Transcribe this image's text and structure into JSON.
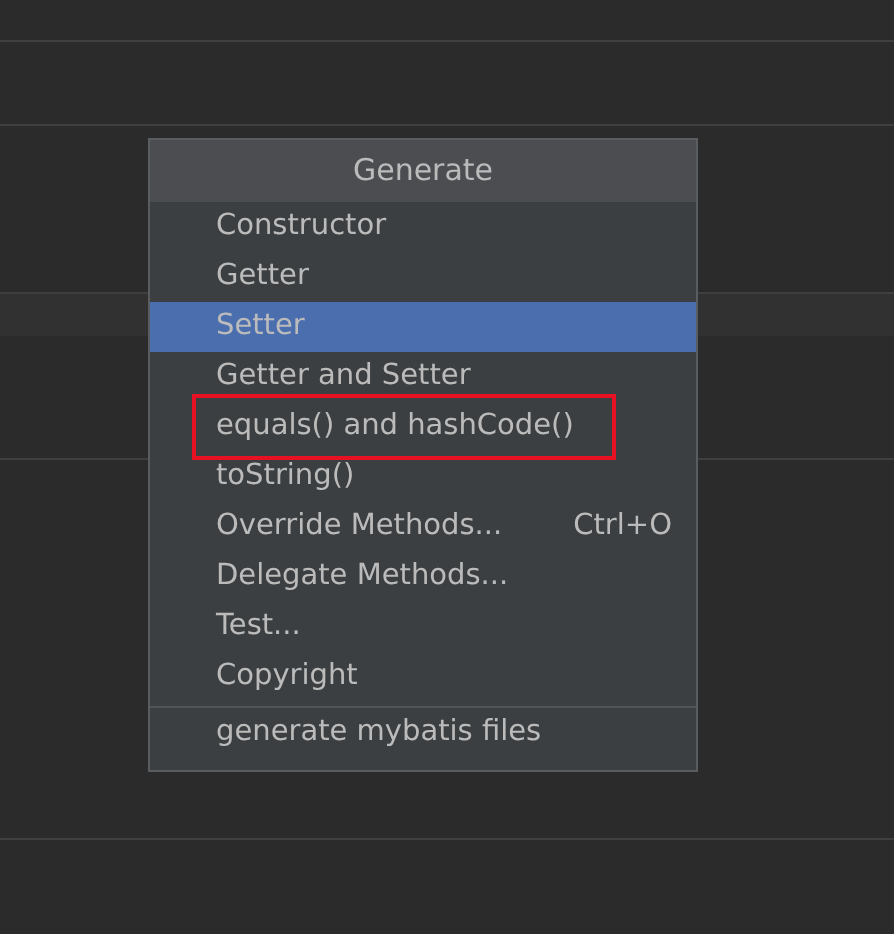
{
  "popup": {
    "title": "Generate",
    "items": [
      {
        "label": "Constructor",
        "selected": false,
        "marked": false
      },
      {
        "label": "Getter",
        "selected": false,
        "marked": false
      },
      {
        "label": "Setter",
        "selected": true,
        "marked": false
      },
      {
        "label": "Getter and Setter",
        "selected": false,
        "marked": false
      },
      {
        "label": "equals() and hashCode()",
        "selected": false,
        "marked": true
      },
      {
        "label": "toString()",
        "selected": false,
        "marked": false
      },
      {
        "label": "Override Methods...",
        "shortcut": "Ctrl+O",
        "selected": false,
        "marked": false
      },
      {
        "label": "Delegate Methods...",
        "selected": false,
        "marked": false
      },
      {
        "label": "Test...",
        "selected": false,
        "marked": false
      },
      {
        "label": "Copyright",
        "selected": false,
        "marked": false
      }
    ],
    "extra_items": [
      {
        "label": "generate mybatis files",
        "selected": false,
        "marked": false
      }
    ]
  }
}
